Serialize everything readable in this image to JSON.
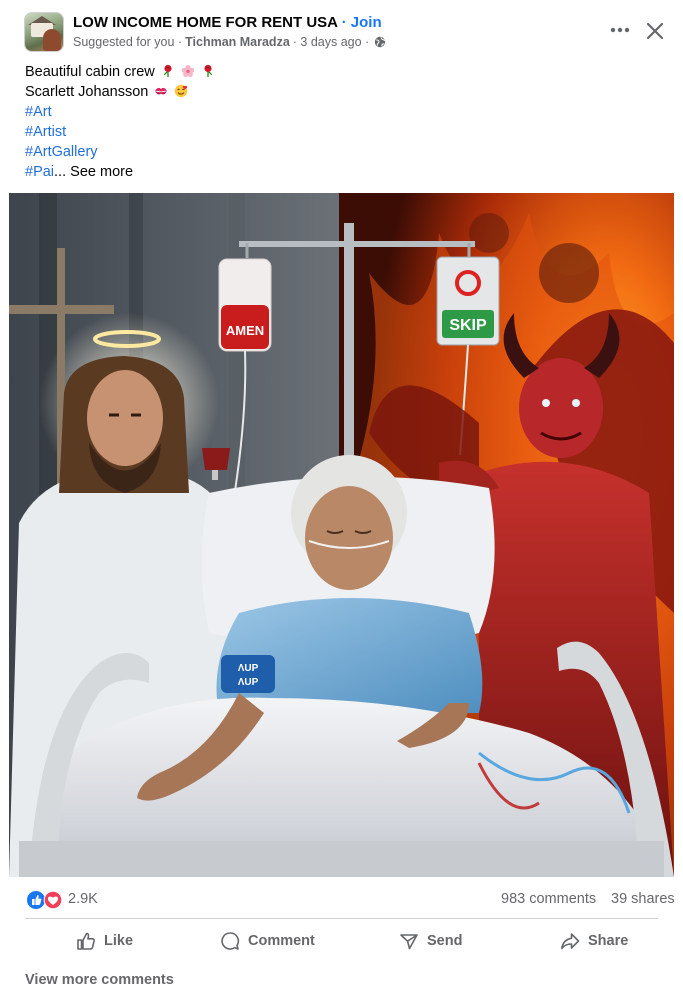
{
  "post": {
    "page_name": "LOW INCOME HOME FOR RENT USA",
    "separator": "·",
    "join_label": "Join",
    "suggested": "Suggested for you ·",
    "author": "Tichman Maradza",
    "time": "· 3 days ago ·",
    "caption": {
      "line1": "Beautiful cabin crew",
      "line2": "Scarlett Johansson",
      "hashtags": [
        "#Art",
        "#Artist",
        "#ArtGallery"
      ],
      "truncated_tag": "#Pai",
      "ellipsis": "...",
      "see_more": "See more"
    },
    "image": {
      "iv_bag_label": "AMEN",
      "sign_label": "SKIP",
      "armband_text_1": "ΛUP",
      "armband_text_2": "ΛUP"
    }
  },
  "stats": {
    "reactions": "2.9K",
    "comments": "983 comments",
    "shares": "39 shares"
  },
  "actions": {
    "like": "Like",
    "comment": "Comment",
    "send": "Send",
    "share": "Share"
  },
  "footer": {
    "view_more": "View more comments"
  },
  "colors": {
    "link_blue": "#1877f2",
    "hashtag_blue": "#216fdb",
    "muted_text": "#65676b",
    "like_blue": "#1877f2",
    "love_red": "#f33e58"
  },
  "icons": [
    "more-icon",
    "close-icon",
    "globe-icon",
    "like-reaction-icon",
    "love-reaction-icon",
    "like-icon",
    "comment-icon",
    "send-icon",
    "share-icon"
  ]
}
